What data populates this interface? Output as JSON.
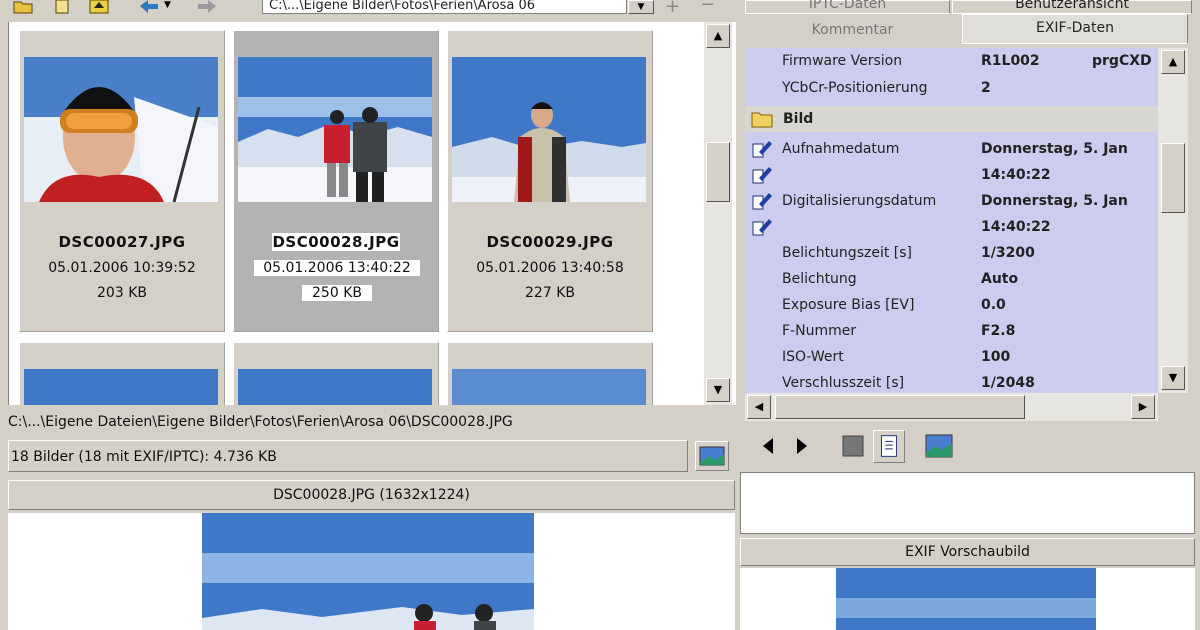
{
  "toolbar": {
    "path_value": "C:\\...\\Eigene Bilder\\Fotos\\Ferien\\Arosa 06",
    "icons": [
      "open-folder-icon",
      "new-folder-icon",
      "up-folder-icon",
      "back-arrow-icon",
      "forward-arrow-icon",
      "add-icon",
      "remove-icon"
    ]
  },
  "thumbnails": [
    {
      "name": "DSC00027.JPG",
      "date": "05.01.2006 10:39:52",
      "size": "203 KB",
      "selected": false
    },
    {
      "name": "DSC00028.JPG",
      "date": "05.01.2006 13:40:22",
      "size": "250 KB",
      "selected": true
    },
    {
      "name": "DSC00029.JPG",
      "date": "05.01.2006 13:40:58",
      "size": "227 KB",
      "selected": false
    }
  ],
  "status": {
    "path": "C:\\...\\Eigene Dateien\\Eigene Bilder\\Fotos\\Ferien\\Arosa 06\\DSC00028.JPG",
    "count": "18 Bilder (18 mit EXIF/IPTC): 4.736 KB"
  },
  "preview": {
    "header": "DSC00028.JPG (1632x1224)"
  },
  "right_panel": {
    "tabs": {
      "iptc": "IPTC-Daten",
      "user_view": "Benutzeransicht",
      "comment": "Kommentar",
      "exif": "EXIF-Daten"
    },
    "exif_rows_top": [
      {
        "label": "Firmware Version",
        "value": "R1L002",
        "value2": "prgCXD"
      },
      {
        "label": "YCbCr-Positionierung",
        "value": "2",
        "value2": ""
      }
    ],
    "group_label": "Bild",
    "exif_rows": [
      {
        "label": "Aufnahmedatum",
        "value": "Donnerstag, 5. Jan",
        "icon": true
      },
      {
        "label": "",
        "value": "14:40:22",
        "icon": true
      },
      {
        "label": "Digitalisierungsdatum",
        "value": "Donnerstag, 5. Jan",
        "icon": true
      },
      {
        "label": "",
        "value": "14:40:22",
        "icon": true
      },
      {
        "label": "Belichtungszeit [s]",
        "value": "1/3200",
        "icon": false
      },
      {
        "label": "Belichtung",
        "value": "Auto",
        "icon": false
      },
      {
        "label": "Exposure Bias [EV]",
        "value": "0.0",
        "icon": false
      },
      {
        "label": "F-Nummer",
        "value": "F2.8",
        "icon": false
      },
      {
        "label": "ISO-Wert",
        "value": "100",
        "icon": false
      },
      {
        "label": "Verschlusszeit [s]",
        "value": "1/2048",
        "icon": false
      }
    ],
    "exif_preview_header": "EXIF Vorschaubild"
  },
  "colors": {
    "window_bg": "#d4d0c8",
    "exif_list_bg": "#ccccee",
    "selected_thumb_bg": "#b3b3b3"
  }
}
